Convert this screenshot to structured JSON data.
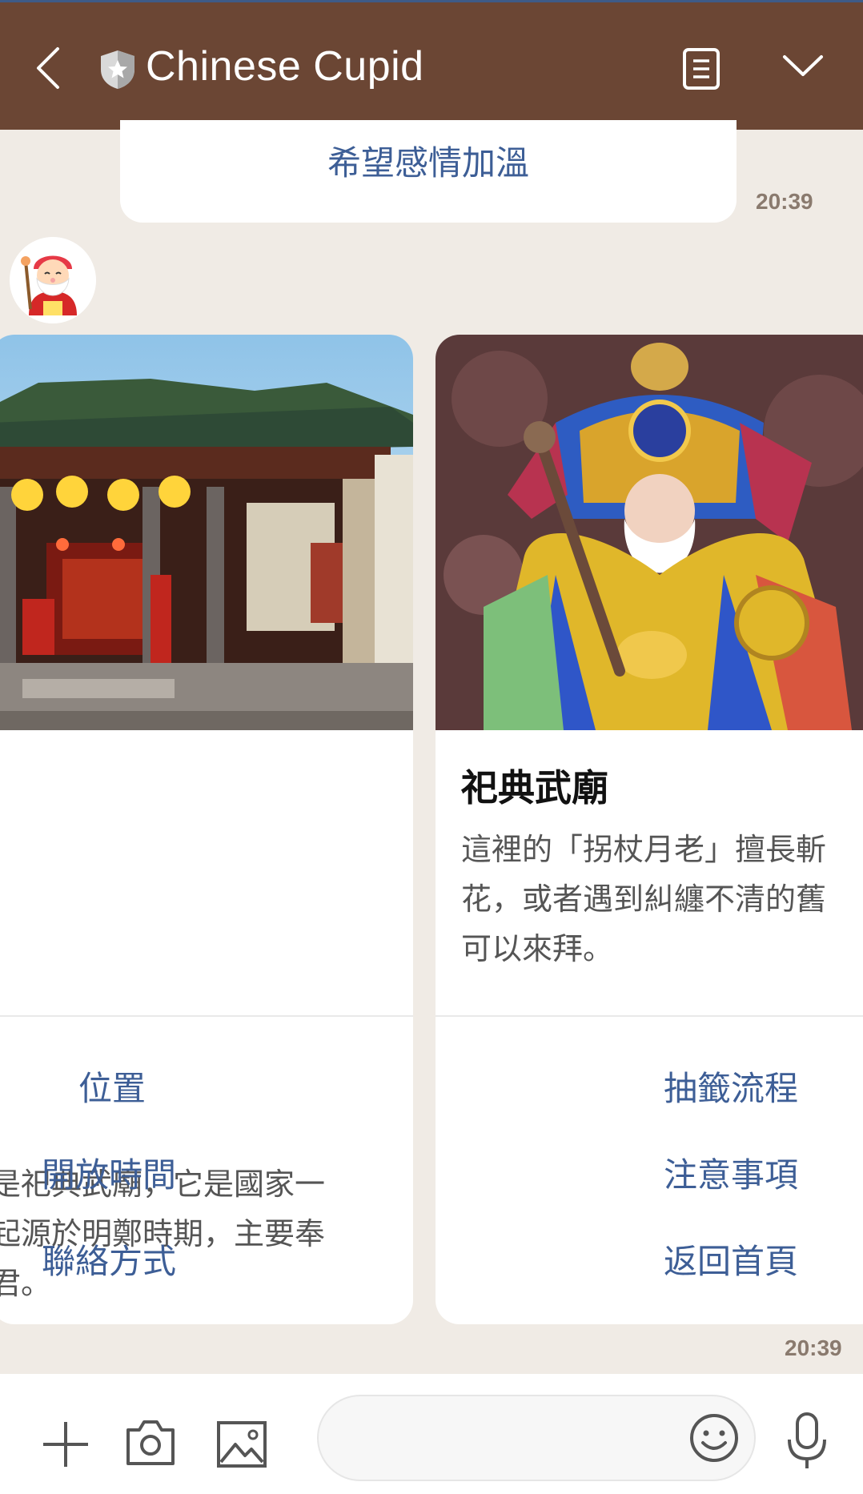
{
  "header": {
    "title": "Chinese Cupid",
    "icons": [
      "back-arrow-icon",
      "shield-star-icon",
      "note-icon",
      "chevron-down-icon"
    ]
  },
  "chat": {
    "prev_message": "希望感情加溫",
    "prev_time": "20:39",
    "carousel_time": "20:39"
  },
  "cards": [
    {
      "title": "",
      "description": [
        "是祀典武廟，它是國家一",
        "起源於明鄭時期，主要奉",
        "君。"
      ],
      "buttons": [
        "位置",
        "開放時間",
        "聯絡方式"
      ]
    },
    {
      "title": "祀典武廟",
      "description": [
        "這裡的「拐杖月老」擅長斬",
        "花，或者遇到糾纏不清的舊",
        "可以來拜。"
      ],
      "buttons": [
        "抽籤流程",
        "注意事項",
        "返回首頁"
      ]
    }
  ],
  "input_bar": {
    "placeholder": "",
    "icons": [
      "plus-icon",
      "camera-icon",
      "image-icon",
      "emoji-icon",
      "microphone-icon"
    ]
  },
  "colors": {
    "header_bg": "#6b4634",
    "chat_bg": "#f0ebe5",
    "link_blue": "#3d5e96"
  }
}
